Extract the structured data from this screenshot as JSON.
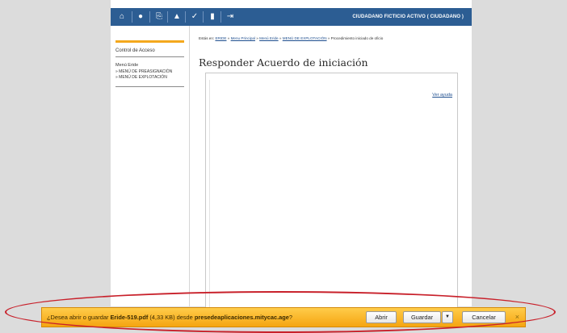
{
  "topbar": {
    "icons": [
      "home-icon",
      "info-icon",
      "print-icon",
      "warning-icon",
      "edit-icon",
      "document-icon",
      "logout-icon"
    ],
    "user_label": "CIUDADANO FICTICIO ACTIVO ( CIUDADANO )"
  },
  "sidebar": {
    "title": "Control de Acceso",
    "menu_head": "Menú Eride",
    "items": [
      "» MENÚ DE PREASIGNACIÓN",
      "» MENÚ DE EXPLOTACIÓN"
    ]
  },
  "breadcrumb": {
    "prefix": "Estás en:",
    "links": [
      "ERIDE",
      "Menu Principal",
      "Menú Eride",
      "MENÚ DE EXPLOTACIÓN"
    ],
    "current": "Procedimiento iniciado de oficio",
    "separator": "»"
  },
  "page_title": "Responder Acuerdo de iniciación",
  "help_link": "Ver ayuda",
  "download_bar": {
    "text_before": "¿Desea abrir o guardar ",
    "filename": "Eride-519.pdf",
    "size": " (4,33 KB) desde ",
    "source": "presedeaplicaciones.mitycac.age",
    "text_after": "?",
    "open_label": "Abrir",
    "save_label": "Guardar",
    "cancel_label": "Cancelar",
    "close_label": "×"
  },
  "colors": {
    "topbar": "#2c5d93",
    "accent": "#f4a81d",
    "notification": "#f5a511",
    "highlight_ellipse": "#c8202a"
  }
}
